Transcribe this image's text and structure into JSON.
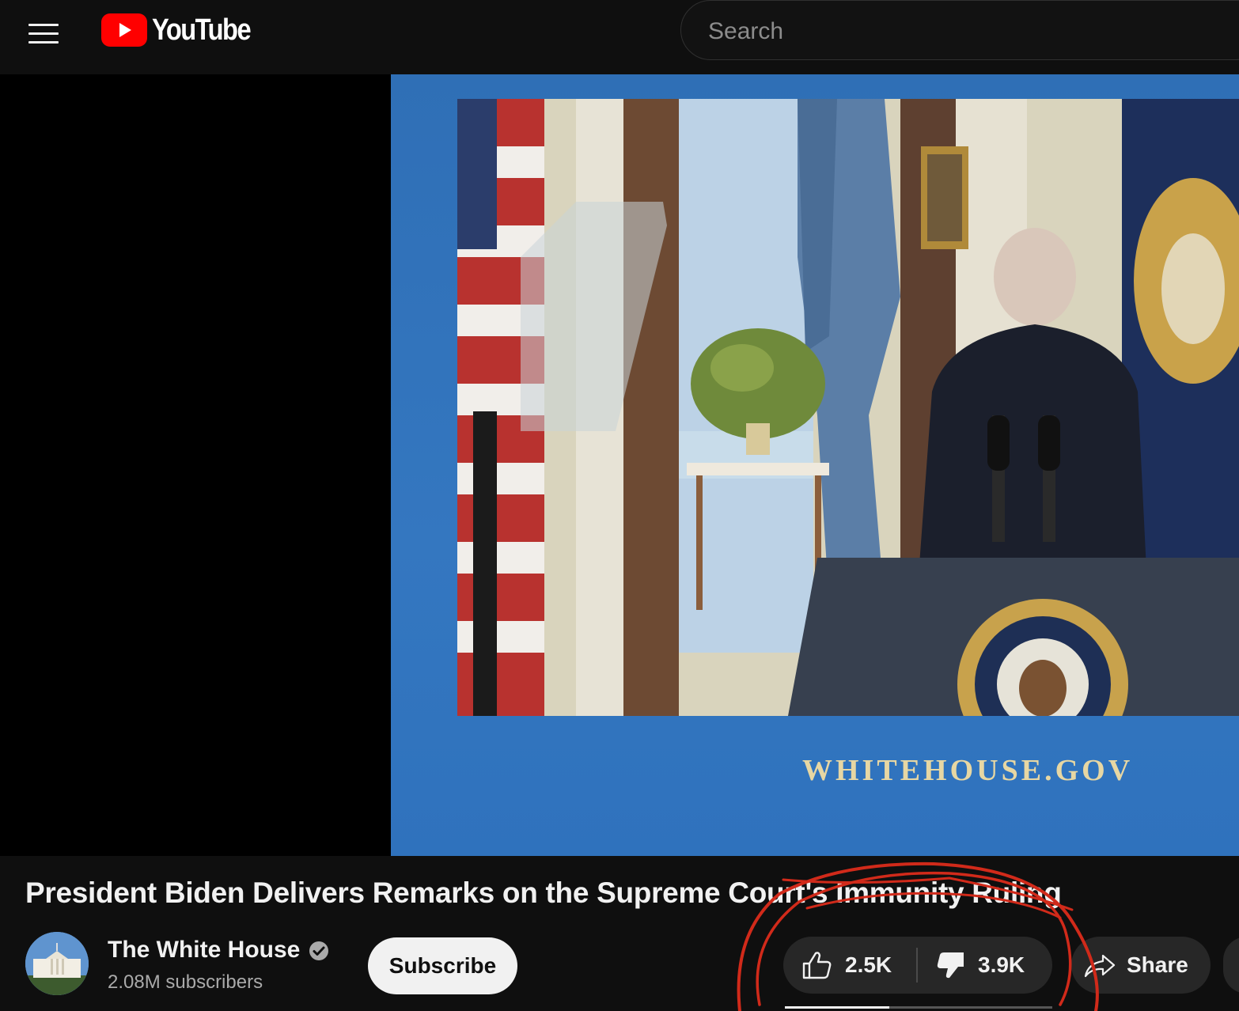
{
  "header": {
    "logo_text": "YouTube",
    "search_placeholder": "Search"
  },
  "video": {
    "watermark": "WHITEHOUSE.GOV",
    "title": "President Biden Delivers Remarks on the Supreme Court's Immunity Ruling"
  },
  "channel": {
    "name": "The White House",
    "subscribers": "2.08M subscribers",
    "verified": true
  },
  "actions": {
    "subscribe_label": "Subscribe",
    "like_count": "2.5K",
    "dislike_count": "3.9K",
    "like_ratio": 0.39,
    "share_label": "Share"
  },
  "colors": {
    "brand_red": "#ff0000",
    "background": "#0f0f0f",
    "annotation_red": "#d12a1a"
  },
  "icons": [
    "menu-icon",
    "youtube-logo-icon",
    "verified-icon",
    "like-icon",
    "dislike-icon",
    "share-icon"
  ]
}
